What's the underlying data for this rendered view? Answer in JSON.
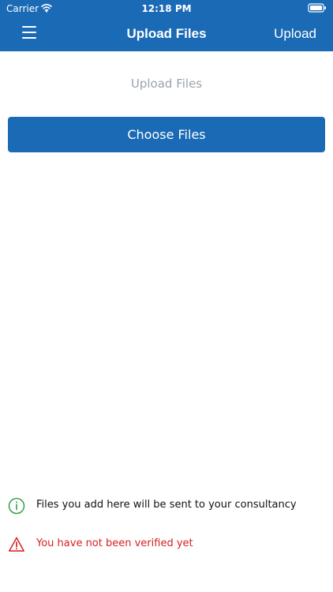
{
  "status_bar": {
    "carrier": "Carrier",
    "time": "12:18 PM"
  },
  "header": {
    "title": "Upload Files",
    "action_label": "Upload"
  },
  "content": {
    "section_title": "Upload Files",
    "choose_files_label": "Choose Files"
  },
  "notices": {
    "info": "Files you add here will be sent to your consultancy",
    "warning": "You have not been verified yet"
  },
  "icons": {
    "menu": "menu-icon",
    "wifi": "wifi-icon",
    "battery": "battery-icon",
    "info": "info-icon",
    "warning": "warning-icon"
  },
  "colors": {
    "primary": "#1b6ab6",
    "muted_text": "#9ca3ad",
    "info_green": "#2fa24a",
    "warning_red": "#d61f1f"
  }
}
